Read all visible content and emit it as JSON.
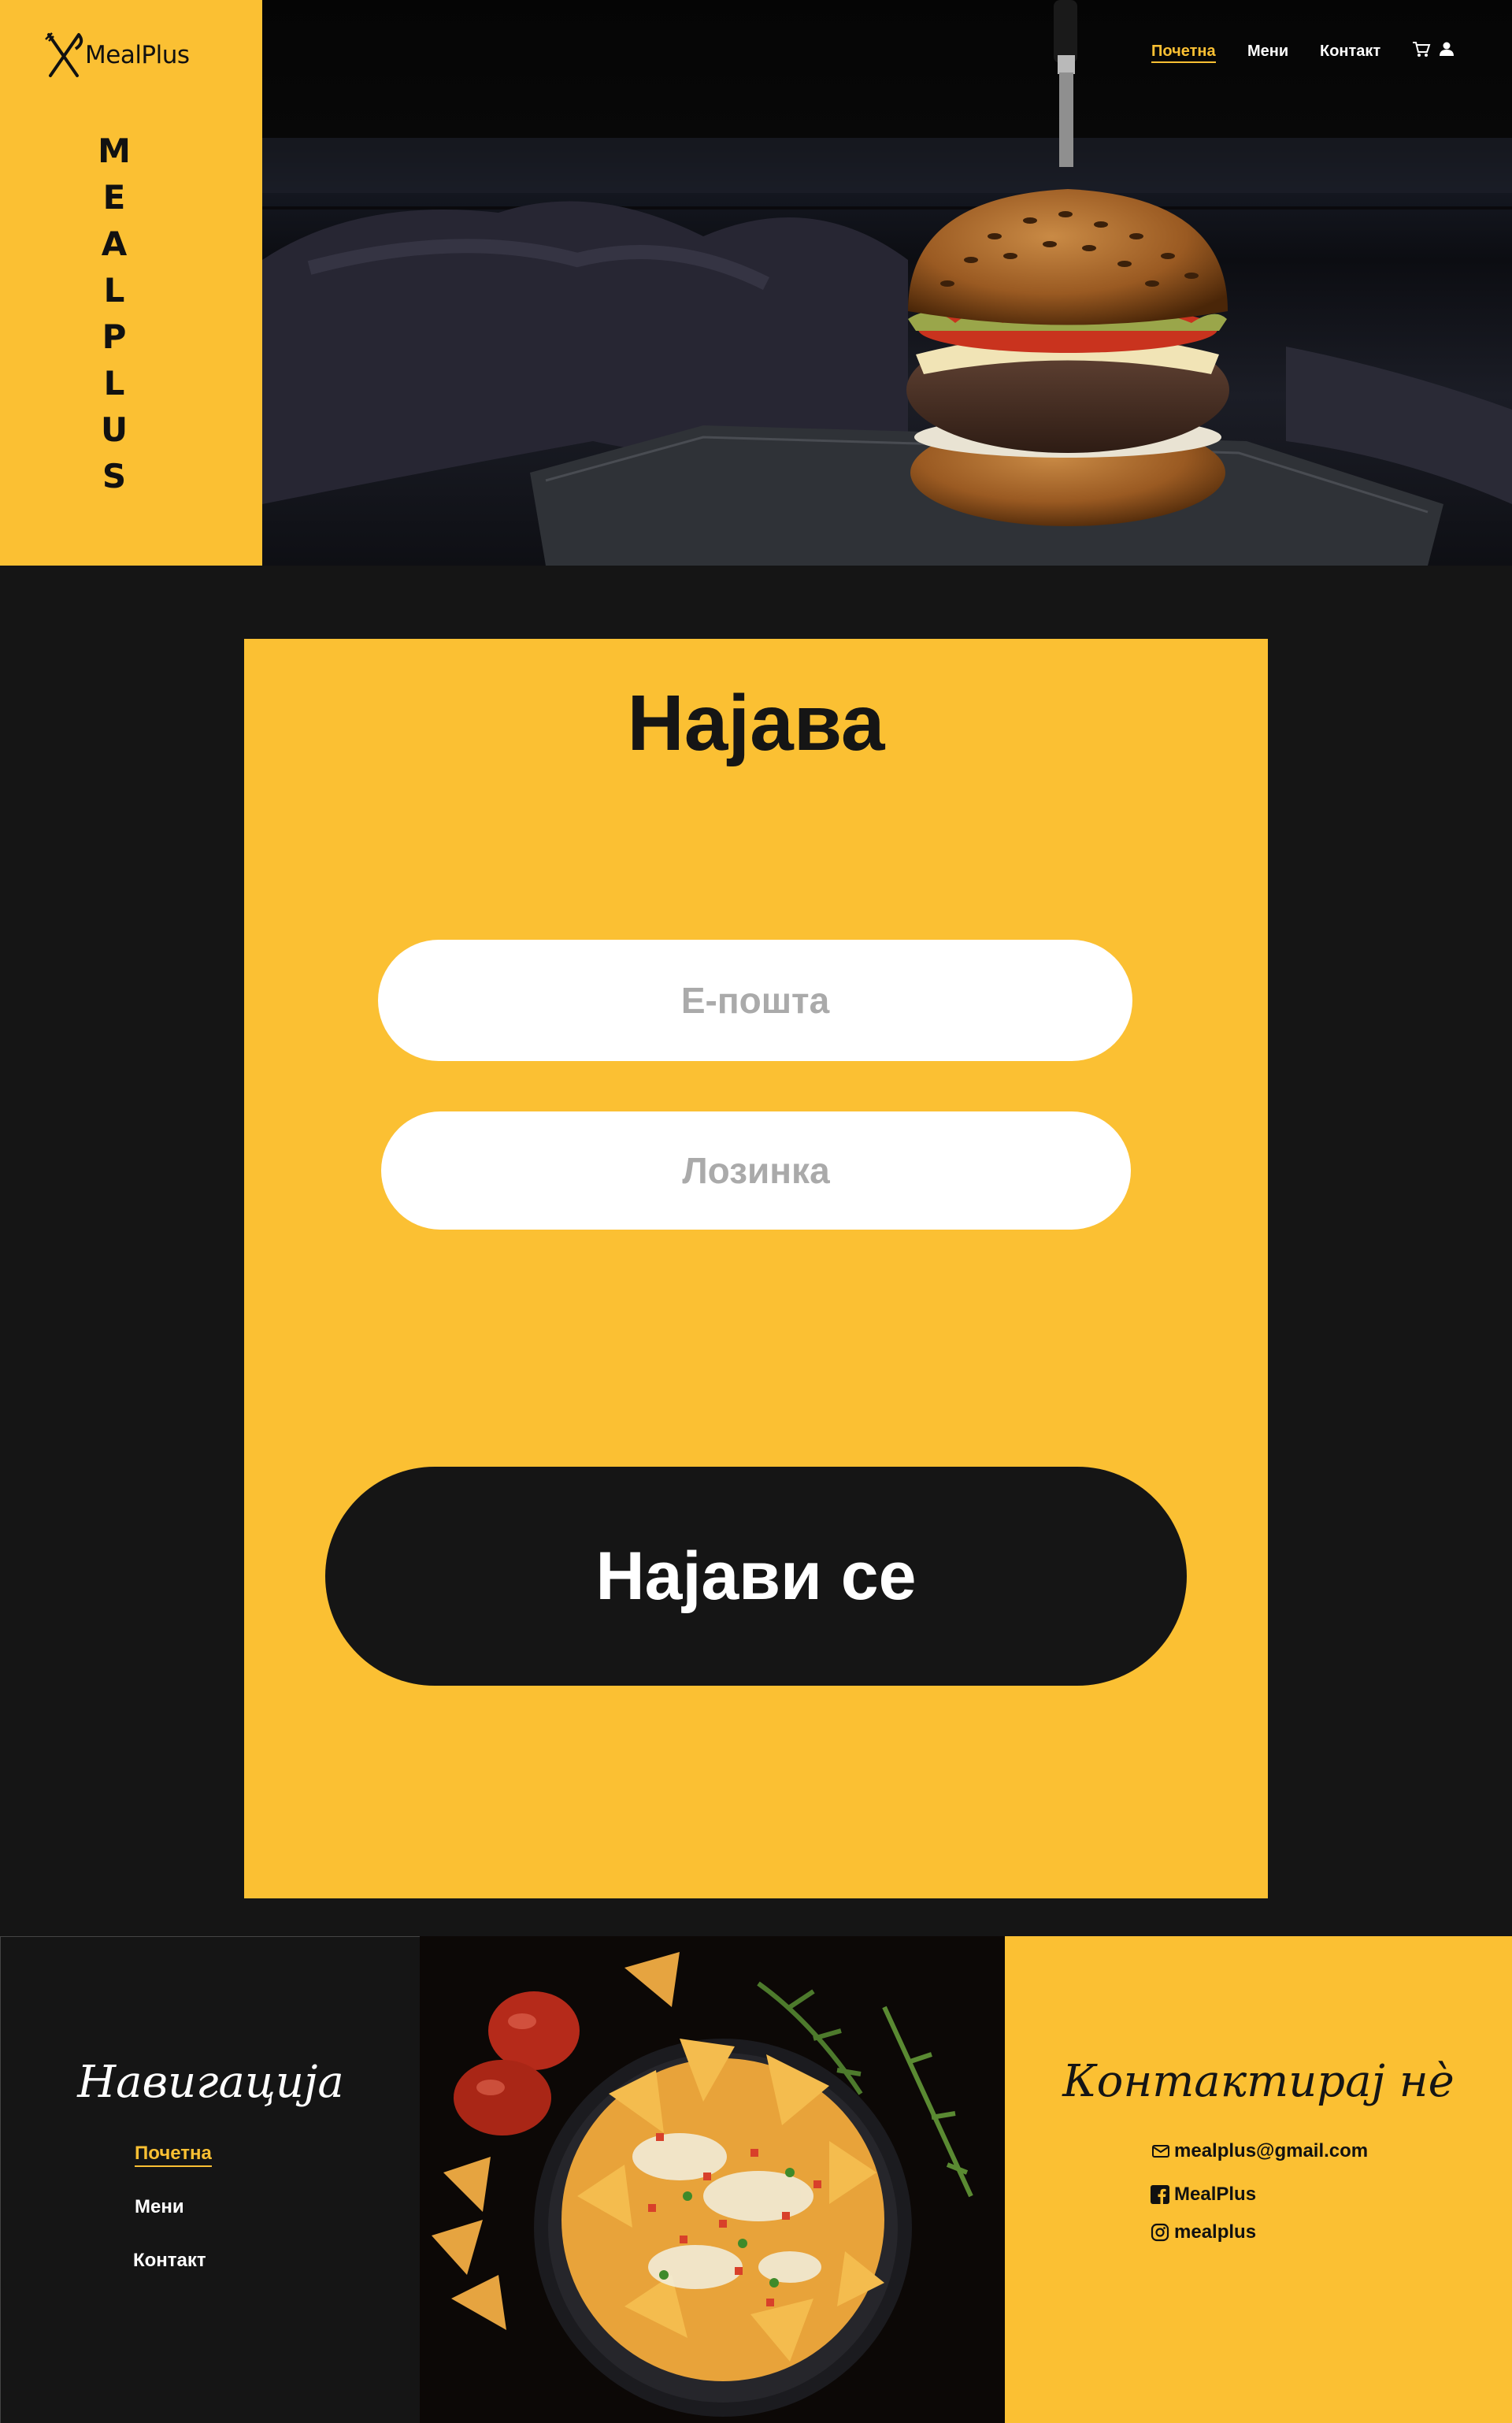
{
  "brand": {
    "logo_text": "MealPlus",
    "vertical_word": [
      "M",
      "E",
      "A",
      "L",
      "P",
      "L",
      "U",
      "S"
    ],
    "accent_color": "#FBC033",
    "dark_color": "#151515"
  },
  "nav": {
    "items": [
      {
        "label": "Почетна",
        "active": true
      },
      {
        "label": "Мени",
        "active": false
      },
      {
        "label": "Контакт",
        "active": false
      }
    ],
    "icons": [
      "cart-icon",
      "user-icon"
    ]
  },
  "login": {
    "title": "Најава",
    "email_placeholder": "Е-пошта",
    "password_placeholder": "Лозинка",
    "submit_label": "Најави се"
  },
  "footer": {
    "nav_title": "Навигација",
    "nav_items": [
      {
        "label": "Почетна",
        "active": true
      },
      {
        "label": "Мени",
        "active": false
      },
      {
        "label": "Контакт",
        "active": false
      }
    ],
    "contact_title": "Контактирај нè",
    "contacts": [
      {
        "icon": "mail-icon",
        "label": "mealplus@gmail.com"
      },
      {
        "icon": "facebook-icon",
        "label": "MealPlus"
      },
      {
        "icon": "instagram-icon",
        "label": "mealplus"
      }
    ]
  }
}
